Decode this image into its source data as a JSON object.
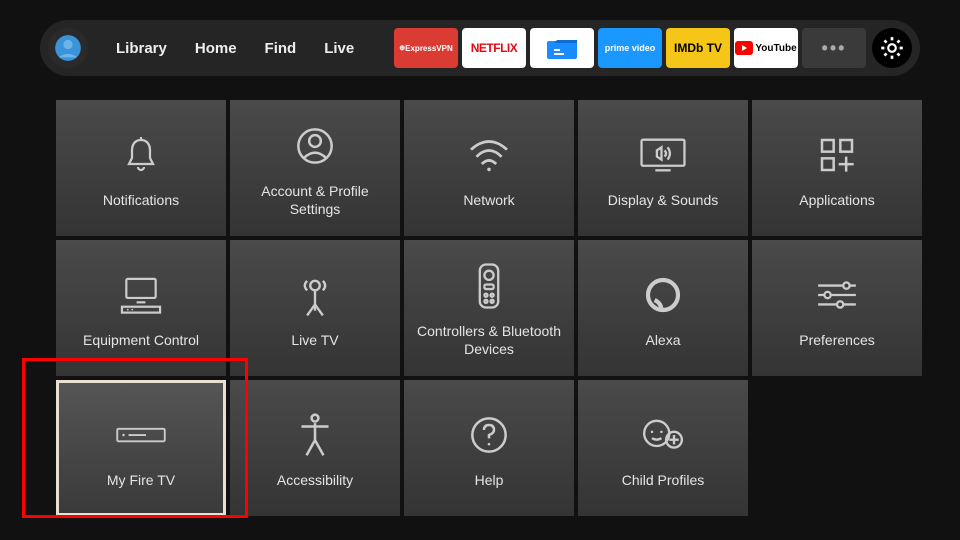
{
  "nav": {
    "items": [
      "Library",
      "Home",
      "Find",
      "Live"
    ]
  },
  "apps": {
    "express": "ExpressVPN",
    "netflix": "NETFLIX",
    "prime": "prime video",
    "imdb": "IMDb TV",
    "youtube": "YouTube",
    "more": "•••"
  },
  "tiles": [
    {
      "label": "Notifications",
      "icon": "bell-icon"
    },
    {
      "label": "Account & Profile Settings",
      "icon": "person-circle-icon"
    },
    {
      "label": "Network",
      "icon": "wifi-icon"
    },
    {
      "label": "Display & Sounds",
      "icon": "display-icon"
    },
    {
      "label": "Applications",
      "icon": "apps-icon"
    },
    {
      "label": "Equipment Control",
      "icon": "equipment-icon"
    },
    {
      "label": "Live TV",
      "icon": "antenna-icon"
    },
    {
      "label": "Controllers & Bluetooth Devices",
      "icon": "remote-icon"
    },
    {
      "label": "Alexa",
      "icon": "alexa-icon"
    },
    {
      "label": "Preferences",
      "icon": "sliders-icon"
    },
    {
      "label": "My Fire TV",
      "icon": "firetv-icon"
    },
    {
      "label": "Accessibility",
      "icon": "accessibility-icon"
    },
    {
      "label": "Help",
      "icon": "help-icon"
    },
    {
      "label": "Child Profiles",
      "icon": "child-icon"
    }
  ],
  "selected_tile_index": 10
}
